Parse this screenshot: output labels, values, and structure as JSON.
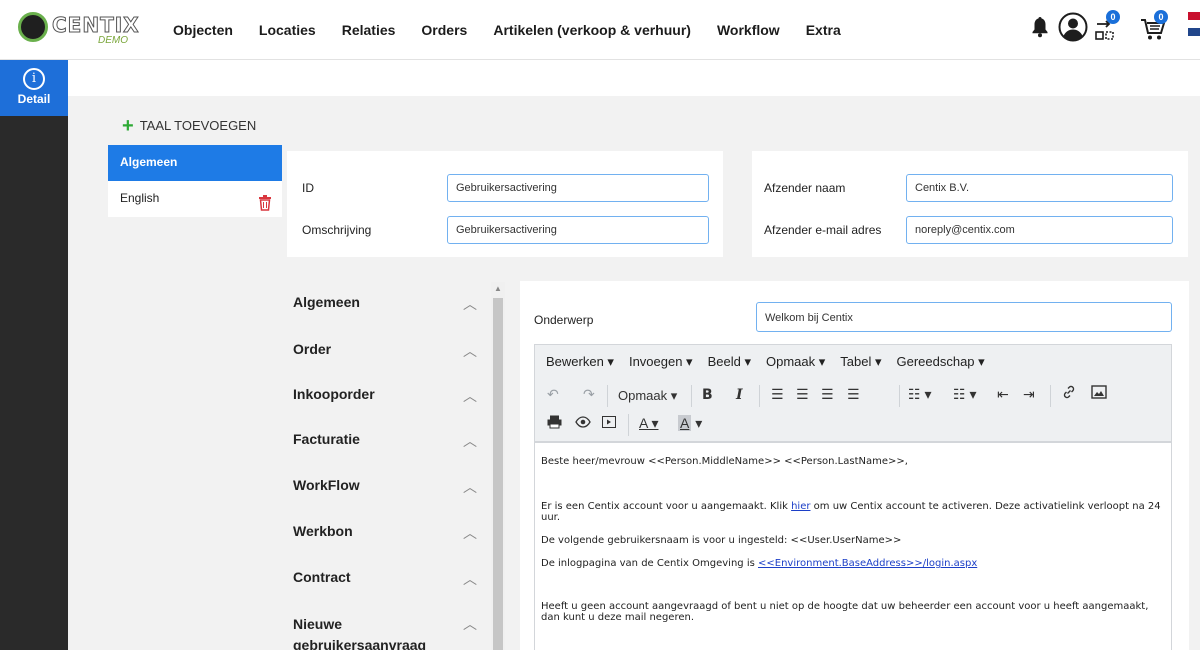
{
  "app": {
    "logo_text": "CENTIX",
    "logo_sub": "DEMO"
  },
  "nav": {
    "items": [
      "Objecten",
      "Locaties",
      "Relaties",
      "Orders",
      "Artikelen (verkoop & verhuur)",
      "Workflow",
      "Extra"
    ]
  },
  "top_icons": {
    "bell": "bell-icon",
    "user": "user-icon",
    "transfer_badge": "0",
    "cart_badge": "0"
  },
  "sidebar": {
    "detail_label": "Detail"
  },
  "languages": {
    "add_label": "TAAL TOEVOEGEN",
    "items": [
      {
        "label": "Algemeen",
        "active": true
      },
      {
        "label": "English",
        "active": false
      }
    ]
  },
  "form": {
    "id_label": "ID",
    "id_value": "Gebruikersactivering",
    "description_label": "Omschrijving",
    "description_value": "Gebruikersactivering",
    "sender_name_label": "Afzender naam",
    "sender_name_value": "Centix B.V.",
    "sender_email_label": "Afzender e-mail adres",
    "sender_email_value": "noreply@centix.com"
  },
  "accordion": {
    "items": [
      "Algemeen",
      "Order",
      "Inkooporder",
      "Facturatie",
      "WorkFlow",
      "Werkbon",
      "Contract",
      "Nieuwe gebruikersaanvraag"
    ]
  },
  "editor": {
    "subject_label": "Onderwerp",
    "subject_value": "Welkom bij Centix",
    "menu": [
      "Bewerken ▾",
      "Invoegen ▾",
      "Beeld ▾",
      "Opmaak ▾",
      "Tabel ▾",
      "Gereedschap ▾"
    ],
    "format_dropdown": "Opmaak ▾",
    "body": {
      "line1": "Beste heer/mevrouw <<Person.MiddleName>> <<Person.LastName>>,",
      "line2_pre": "Er is een Centix account voor u aangemaakt. Klik ",
      "line2_link": "hier",
      "line2_post": " om uw Centix account te activeren. Deze activatielink verloopt na 24 uur.",
      "line3": "De volgende gebruikersnaam is voor u ingesteld: <<User.UserName>>",
      "line4_pre": "De inlogpagina van de Centix Omgeving is ",
      "line4_link": "<<Environment.BaseAddress>>/login.aspx",
      "line5": "Heeft u geen account aangevraagd of bent u niet op de hoogte dat uw beheerder een account voor u heeft aangemaakt, dan kunt u deze mail negeren."
    }
  },
  "colors": {
    "accent": "#1e7be6",
    "sidebar": "#2a2a2a",
    "add_green": "#2eaa35",
    "delete_red": "#d9363e"
  }
}
